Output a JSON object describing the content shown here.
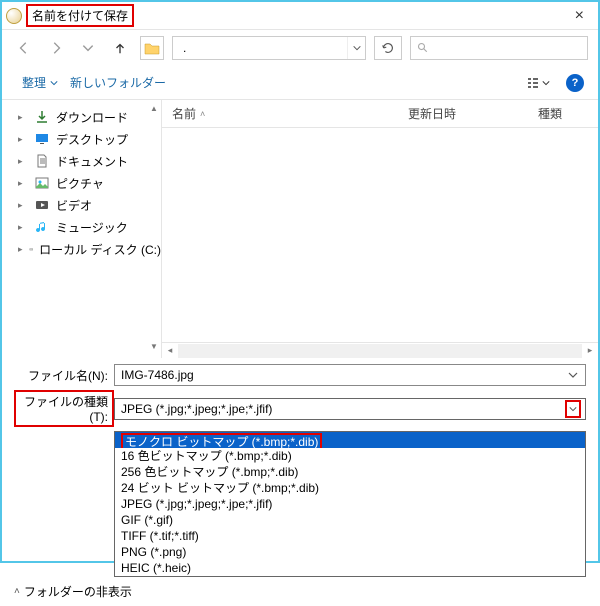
{
  "title": "名前を付けて保存",
  "breadcrumb": {
    "segment": "."
  },
  "search": {
    "placeholder": ""
  },
  "toolbar": {
    "organize": "整理",
    "newfolder": "新しいフォルダー"
  },
  "columns": {
    "name": "名前",
    "date": "更新日時",
    "type": "種類"
  },
  "sidebar": [
    {
      "label": "ダウンロード",
      "icon": "download"
    },
    {
      "label": "デスクトップ",
      "icon": "desktop"
    },
    {
      "label": "ドキュメント",
      "icon": "document"
    },
    {
      "label": "ピクチャ",
      "icon": "pictures"
    },
    {
      "label": "ビデオ",
      "icon": "video"
    },
    {
      "label": "ミュージック",
      "icon": "music"
    },
    {
      "label": "ローカル ディスク (C:)",
      "icon": "disk"
    }
  ],
  "form": {
    "filename_label": "ファイル名(N):",
    "filename_value": "IMG-7486.jpg",
    "filetype_label": "ファイルの種類(T):",
    "filetype_value": "JPEG (*.jpg;*.jpeg;*.jpe;*.jfif)"
  },
  "dropdown": [
    {
      "label": "モノクロ ビットマップ (*.bmp;*.dib)",
      "selected": true
    },
    {
      "label": "16 色ビットマップ (*.bmp;*.dib)"
    },
    {
      "label": "256 色ビットマップ (*.bmp;*.dib)"
    },
    {
      "label": "24 ビット ビットマップ (*.bmp;*.dib)"
    },
    {
      "label": "JPEG (*.jpg;*.jpeg;*.jpe;*.jfif)"
    },
    {
      "label": "GIF (*.gif)"
    },
    {
      "label": "TIFF (*.tif;*.tiff)"
    },
    {
      "label": "PNG (*.png)"
    },
    {
      "label": "HEIC (*.heic)"
    }
  ],
  "footer": {
    "hide_folders": "フォルダーの非表示"
  }
}
